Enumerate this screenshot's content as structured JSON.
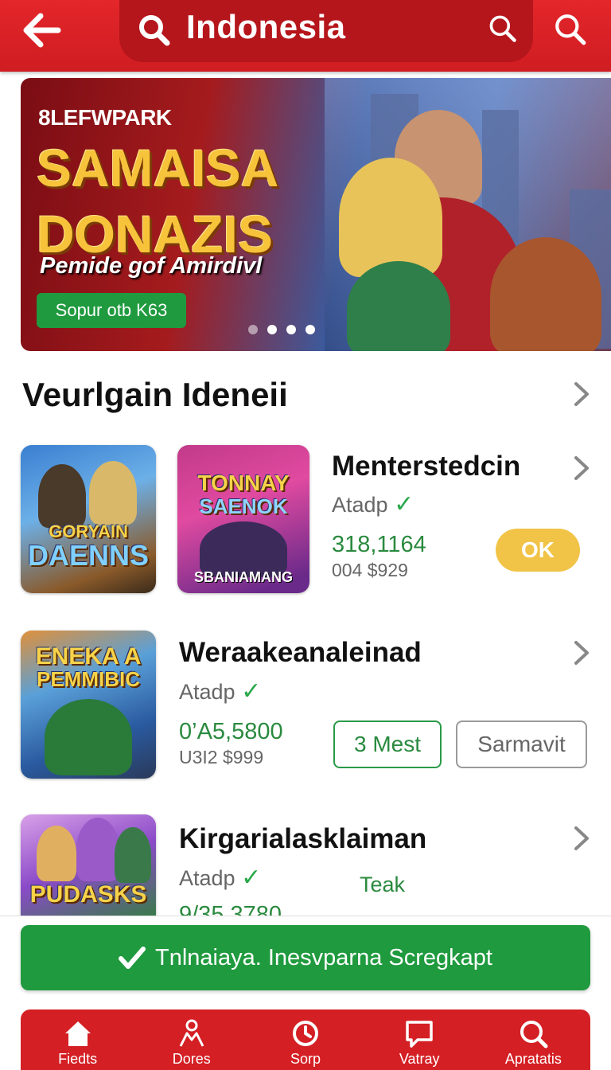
{
  "header": {
    "title": "Indonesia",
    "back_icon": "arrow-left-icon",
    "search_icon": "search-icon",
    "colors": {
      "bar": "#d41f24",
      "pill": "#b5161b"
    }
  },
  "banner": {
    "brand": "8LEFWPARK",
    "headline_line1": "SAMAISA",
    "headline_line2": "DONAZIS",
    "subline": "Pemide gof Amirdivl",
    "cta_label": "Sopur otb K63",
    "slide_count": 4,
    "active_slide": 2
  },
  "section": {
    "title": "Veurlgain Ideneii"
  },
  "rows": [
    {
      "title": "Menterstedcin",
      "subtitle": "Atadp",
      "price": "318,1164",
      "meta": "004 $929",
      "action_label": "OK",
      "thumbs": [
        {
          "label_line1": "GORYAIN",
          "label_line2": "DAENNS"
        },
        {
          "label_line1": "TONNAY",
          "label_line2": "SAENOK",
          "label_line3": "SBANIAMANG"
        }
      ]
    },
    {
      "title": "Weraakeanaleinad",
      "subtitle": "Atadp",
      "price": "0’A5,5800",
      "meta": "U3I2 $999",
      "primary_label": "3 Mest",
      "secondary_label": "Sarmavit",
      "thumbs": [
        {
          "label_line1": "ENEKA A",
          "label_line2": "PEMMIBIC"
        }
      ]
    },
    {
      "title": "Kirgarialasklaiman",
      "subtitle": "Atadp",
      "price": "9/35 3780",
      "extra": "Teak",
      "thumbs": [
        {
          "label_line1": "PUDASKS"
        }
      ]
    }
  ],
  "action_bar": {
    "label": "Tnlnaiaya. Inesvparna Scregkapt",
    "icon": "check-icon",
    "color": "#1f9a3e"
  },
  "tabs": [
    {
      "label": "Fiedts",
      "icon": "home-icon"
    },
    {
      "label": "Dores",
      "icon": "people-icon"
    },
    {
      "label": "Sorp",
      "icon": "refresh-icon"
    },
    {
      "label": "Vatray",
      "icon": "chat-icon"
    },
    {
      "label": "Apratatis",
      "icon": "search-icon"
    }
  ]
}
